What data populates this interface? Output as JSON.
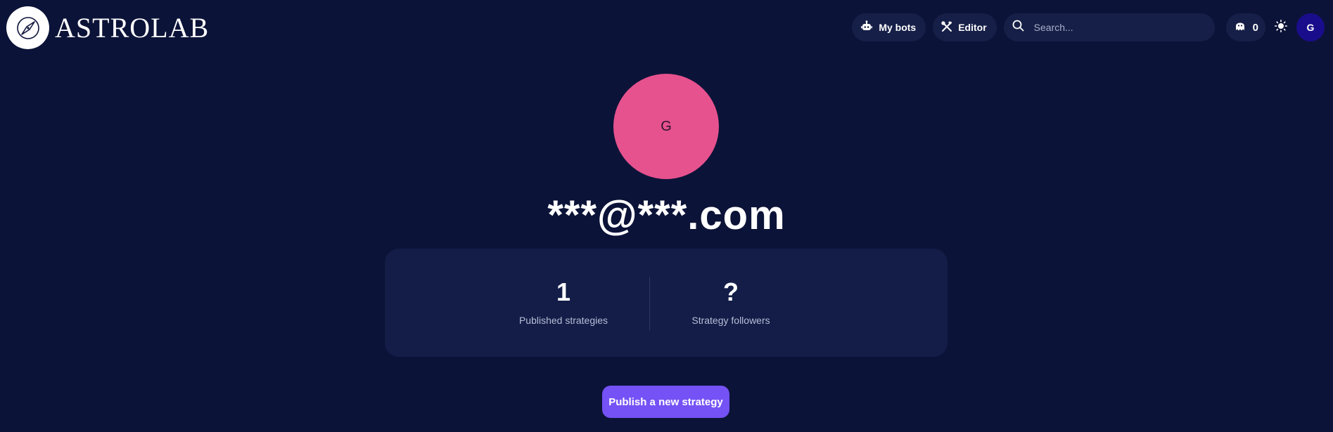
{
  "brand": {
    "name": "ASTROLAB",
    "icon": "compass-icon"
  },
  "nav": {
    "my_bots_label": "My bots",
    "my_bots_icon": "robot-icon",
    "editor_label": "Editor",
    "editor_icon": "tools-icon",
    "search_placeholder": "Search...",
    "search_icon": "search-icon",
    "notification_count": "0",
    "notification_icon": "ghost-icon",
    "theme_icon": "sun-icon",
    "avatar_initial": "G"
  },
  "profile": {
    "avatar_initial": "G",
    "avatar_color": "#e6528e",
    "name": "***@***.com"
  },
  "stats": [
    {
      "value": "1",
      "label": "Published strategies"
    },
    {
      "value": "?",
      "label": "Strategy followers"
    }
  ],
  "actions": {
    "publish_label": "Publish a new strategy"
  },
  "colors": {
    "background": "#0c1338",
    "card": "#131d48",
    "accent": "#7452f5",
    "nav_avatar": "#1a0d8c"
  }
}
